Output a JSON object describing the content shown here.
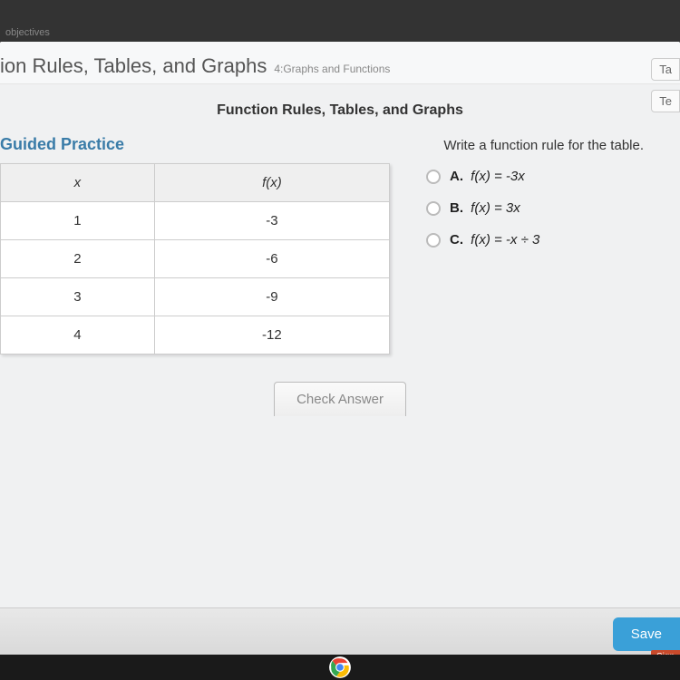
{
  "tab": "objectives",
  "header": {
    "title_partial": "ion Rules, Tables, and Graphs",
    "subtitle": "4:Graphs and Functions"
  },
  "top_right": {
    "chip1": "Ta",
    "chip2": "Te"
  },
  "section_subtitle": "Function Rules, Tables, and Graphs",
  "guided_practice_label": "Guided Practice",
  "prompt": "Write a function rule for the table.",
  "table": {
    "headers": {
      "x": "x",
      "fx": "f(x)"
    },
    "rows": [
      {
        "x": "1",
        "fx": "-3"
      },
      {
        "x": "2",
        "fx": "-6"
      },
      {
        "x": "3",
        "fx": "-9"
      },
      {
        "x": "4",
        "fx": "-12"
      }
    ]
  },
  "choices": [
    {
      "letter": "A.",
      "text": "f(x) = -3x"
    },
    {
      "letter": "B.",
      "text": "f(x) = 3x"
    },
    {
      "letter": "C.",
      "text": "f(x) = -x ÷ 3"
    }
  ],
  "check_answer_label": "Check Answer",
  "save_label": "Save",
  "sign_label": "Sign"
}
